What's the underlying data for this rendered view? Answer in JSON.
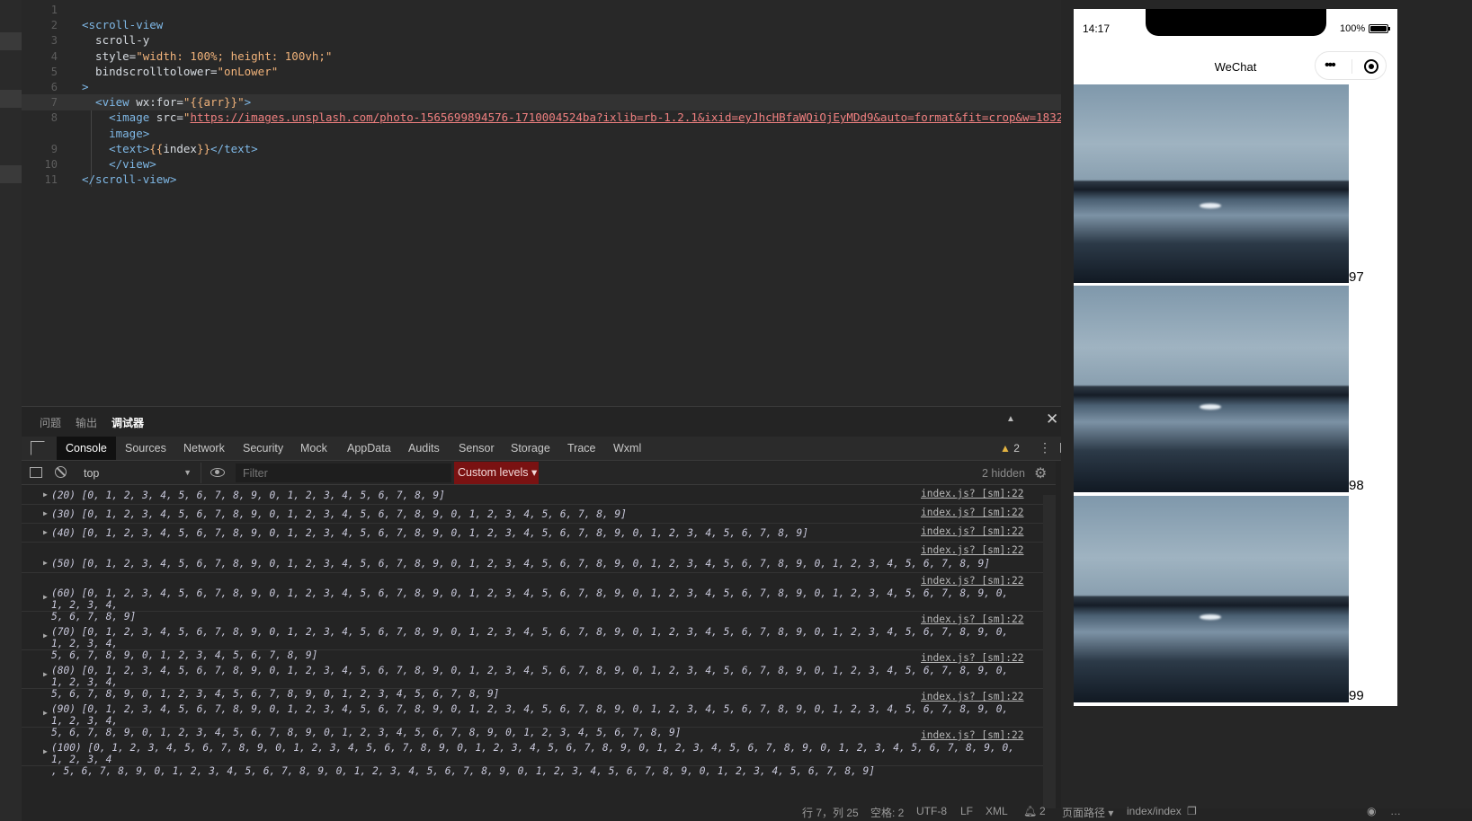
{
  "editor": {
    "lines": [
      {
        "n": "1",
        "segments": []
      },
      {
        "n": "2",
        "segments": [
          {
            "t": "<scroll-view",
            "c": "tag"
          }
        ]
      },
      {
        "n": "3",
        "segments": [
          {
            "t": "  scroll-y",
            "c": "attr"
          }
        ]
      },
      {
        "n": "4",
        "segments": [
          {
            "t": "  style=",
            "c": "attr"
          },
          {
            "t": "\"width: 100%; height: 100vh;\"",
            "c": "str"
          }
        ]
      },
      {
        "n": "5",
        "segments": [
          {
            "t": "  bindscrolltolower=",
            "c": "attr"
          },
          {
            "t": "\"onLower\"",
            "c": "str"
          }
        ]
      },
      {
        "n": "6",
        "segments": [
          {
            "t": ">",
            "c": "tag"
          }
        ]
      },
      {
        "n": "7",
        "segments": [
          {
            "t": "  <view ",
            "c": "tag"
          },
          {
            "t": "wx:for=",
            "c": "attr"
          },
          {
            "t": "\"{{arr}}\"",
            "c": "str"
          },
          {
            "t": ">",
            "c": "tag"
          }
        ]
      },
      {
        "n": "8",
        "segments": [
          {
            "t": "    <image ",
            "c": "tag"
          },
          {
            "t": "src=",
            "c": "attr"
          },
          {
            "t": "\"",
            "c": "str"
          },
          {
            "t": "https://images.unsplash.com/photo-1565699894576-1710004524ba?ixlib=rb-1.2.1&ixid=eyJhcHBfaWQiOjEyMDd9&auto=format&fit=crop&w=1832&q=80",
            "c": "url"
          },
          {
            "t": "\"",
            "c": "str"
          },
          {
            "t": "></",
            "c": "tag"
          }
        ]
      },
      {
        "n": "",
        "segments": [
          {
            "t": "    image>",
            "c": "tag"
          }
        ]
      },
      {
        "n": "9",
        "segments": [
          {
            "t": "    <text>",
            "c": "tag"
          },
          {
            "t": "{{",
            "c": "str"
          },
          {
            "t": "index",
            "c": "attr"
          },
          {
            "t": "}}",
            "c": "str"
          },
          {
            "t": "</text>",
            "c": "tag"
          }
        ]
      },
      {
        "n": "10",
        "segments": [
          {
            "t": "    </view>",
            "c": "tag"
          }
        ]
      },
      {
        "n": "11",
        "segments": [
          {
            "t": "</scroll-view>",
            "c": "tag"
          }
        ]
      }
    ]
  },
  "panel": {
    "tabs": [
      "问题",
      "输出",
      "调试器"
    ],
    "active_tab": "调试器"
  },
  "devtools": {
    "tabs": [
      "Console",
      "Sources",
      "Network",
      "Security",
      "Mock",
      "AppData",
      "Audits",
      "Sensor",
      "Storage",
      "Trace",
      "Wxml"
    ],
    "warning_count": "2",
    "context": "top",
    "filter_placeholder": "Filter",
    "levels_label": "Custom levels ▾",
    "hidden_label": "2 hidden"
  },
  "console": {
    "source": "index.js? [sm]:22",
    "entries": [
      "(20) [0, 1, 2, 3, 4, 5, 6, 7, 8, 9, 0, 1, 2, 3, 4, 5, 6, 7, 8, 9]",
      "(30) [0, 1, 2, 3, 4, 5, 6, 7, 8, 9, 0, 1, 2, 3, 4, 5, 6, 7, 8, 9, 0, 1, 2, 3, 4, 5, 6, 7, 8, 9]",
      "(40) [0, 1, 2, 3, 4, 5, 6, 7, 8, 9, 0, 1, 2, 3, 4, 5, 6, 7, 8, 9, 0, 1, 2, 3, 4, 5, 6, 7, 8, 9, 0, 1, 2, 3, 4, 5, 6, 7, 8, 9]",
      "(50) [0, 1, 2, 3, 4, 5, 6, 7, 8, 9, 0, 1, 2, 3, 4, 5, 6, 7, 8, 9, 0, 1, 2, 3, 4, 5, 6, 7, 8, 9, 0, 1, 2, 3, 4, 5, 6, 7, 8, 9, 0, 1, 2, 3, 4, 5, 6, 7, 8, 9]",
      "(60) [0, 1, 2, 3, 4, 5, 6, 7, 8, 9, 0, 1, 2, 3, 4, 5, 6, 7, 8, 9, 0, 1, 2, 3, 4, 5, 6, 7, 8, 9, 0, 1, 2, 3, 4, 5, 6, 7, 8, 9, 0, 1, 2, 3, 4, 5, 6, 7, 8, 9, 0, 1, 2, 3, 4,\n5, 6, 7, 8, 9]",
      "(70) [0, 1, 2, 3, 4, 5, 6, 7, 8, 9, 0, 1, 2, 3, 4, 5, 6, 7, 8, 9, 0, 1, 2, 3, 4, 5, 6, 7, 8, 9, 0, 1, 2, 3, 4, 5, 6, 7, 8, 9, 0, 1, 2, 3, 4, 5, 6, 7, 8, 9, 0, 1, 2, 3, 4,\n5, 6, 7, 8, 9, 0, 1, 2, 3, 4, 5, 6, 7, 8, 9]",
      "(80) [0, 1, 2, 3, 4, 5, 6, 7, 8, 9, 0, 1, 2, 3, 4, 5, 6, 7, 8, 9, 0, 1, 2, 3, 4, 5, 6, 7, 8, 9, 0, 1, 2, 3, 4, 5, 6, 7, 8, 9, 0, 1, 2, 3, 4, 5, 6, 7, 8, 9, 0, 1, 2, 3, 4,\n5, 6, 7, 8, 9, 0, 1, 2, 3, 4, 5, 6, 7, 8, 9, 0, 1, 2, 3, 4, 5, 6, 7, 8, 9]",
      "(90) [0, 1, 2, 3, 4, 5, 6, 7, 8, 9, 0, 1, 2, 3, 4, 5, 6, 7, 8, 9, 0, 1, 2, 3, 4, 5, 6, 7, 8, 9, 0, 1, 2, 3, 4, 5, 6, 7, 8, 9, 0, 1, 2, 3, 4, 5, 6, 7, 8, 9, 0, 1, 2, 3, 4,\n5, 6, 7, 8, 9, 0, 1, 2, 3, 4, 5, 6, 7, 8, 9, 0, 1, 2, 3, 4, 5, 6, 7, 8, 9, 0, 1, 2, 3, 4, 5, 6, 7, 8, 9]",
      "(100) [0, 1, 2, 3, 4, 5, 6, 7, 8, 9, 0, 1, 2, 3, 4, 5, 6, 7, 8, 9, 0, 1, 2, 3, 4, 5, 6, 7, 8, 9, 0, 1, 2, 3, 4, 5, 6, 7, 8, 9, 0, 1, 2, 3, 4, 5, 6, 7, 8, 9, 0, 1, 2, 3, 4\n, 5, 6, 7, 8, 9, 0, 1, 2, 3, 4, 5, 6, 7, 8, 9, 0, 1, 2, 3, 4, 5, 6, 7, 8, 9, 0, 1, 2, 3, 4, 5, 6, 7, 8, 9, 0, 1, 2, 3, 4, 5, 6, 7, 8, 9]"
    ],
    "prompt": "›"
  },
  "statusbar": {
    "position": "行 7，列 25",
    "spaces": "空格: 2",
    "encoding": "UTF-8",
    "eol": "LF",
    "language": "XML",
    "bell_count": "2",
    "page_path_label": "页面路径 ▾",
    "page_path": "index/index"
  },
  "simulator": {
    "time": "14:17",
    "battery": "100%",
    "title": "WeChat",
    "items": [
      "97",
      "98",
      "99"
    ]
  },
  "colors": {
    "levels_bg": "#7a1212",
    "warning": "#e3b341",
    "prompt": "#5fa9ff"
  }
}
